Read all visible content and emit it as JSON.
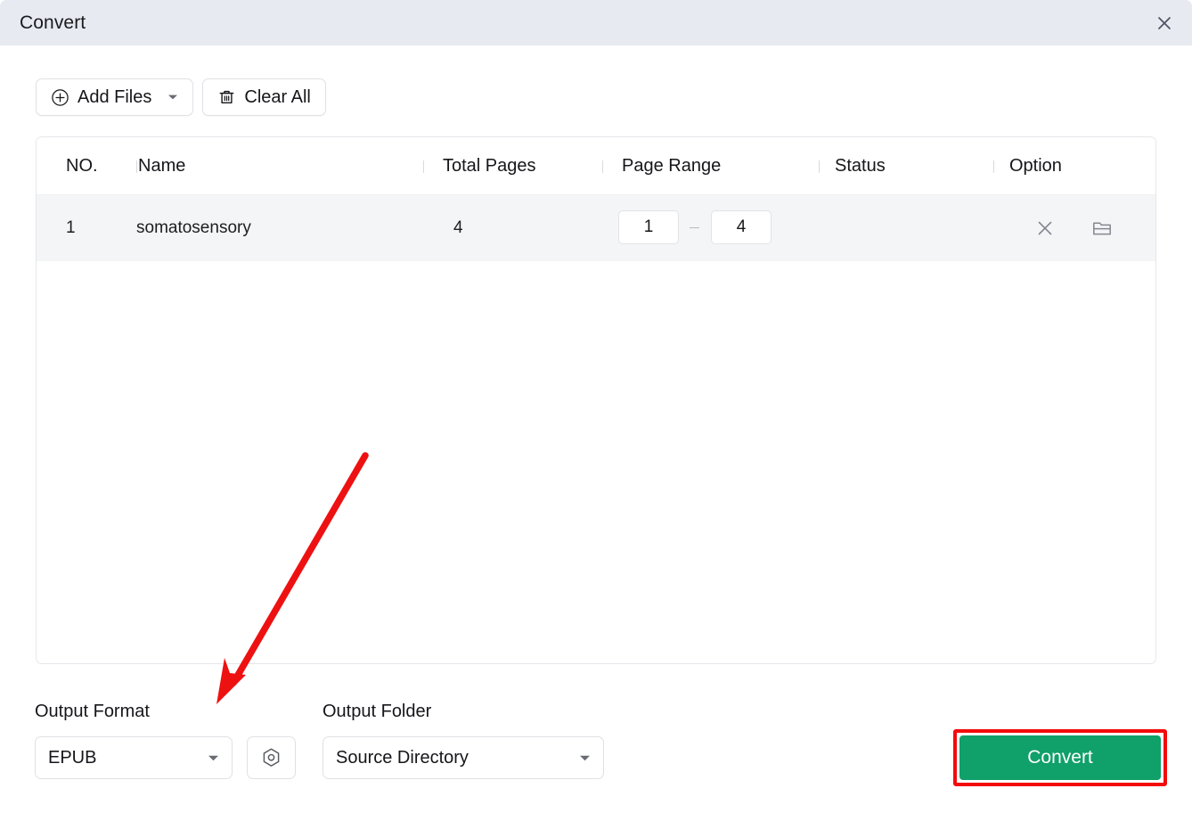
{
  "window": {
    "title": "Convert",
    "close_icon": "close-icon"
  },
  "toolbar": {
    "add_files_label": "Add Files",
    "add_files_icon": "plus-circle-icon",
    "add_files_caret_icon": "chevron-down-icon",
    "clear_all_label": "Clear All",
    "clear_all_icon": "trash-icon"
  },
  "table": {
    "columns": [
      {
        "key": "no",
        "label": "NO."
      },
      {
        "key": "name",
        "label": "Name"
      },
      {
        "key": "total_pages",
        "label": "Total Pages"
      },
      {
        "key": "page_range",
        "label": "Page Range"
      },
      {
        "key": "status",
        "label": "Status"
      },
      {
        "key": "option",
        "label": "Option"
      }
    ],
    "rows": [
      {
        "no": "1",
        "name": "somatosensory",
        "total_pages": "4",
        "page_range_from": "1",
        "page_range_to": "4",
        "status": "",
        "remove_icon": "close-icon",
        "folder_icon": "folder-open-icon"
      }
    ]
  },
  "output": {
    "format_label": "Output Format",
    "format_value": "EPUB",
    "format_caret_icon": "chevron-down-icon",
    "settings_icon": "hex-settings-icon",
    "folder_label": "Output Folder",
    "folder_value": "Source Directory",
    "folder_caret_icon": "chevron-down-icon"
  },
  "actions": {
    "convert_label": "Convert"
  },
  "annotation": {
    "arrow_color": "#ee1111",
    "highlight_color": "#f30b0b"
  },
  "colors": {
    "titlebar_bg": "#e7eaf1",
    "convert_green": "#10a06a",
    "row_bg": "#f4f5f7"
  }
}
